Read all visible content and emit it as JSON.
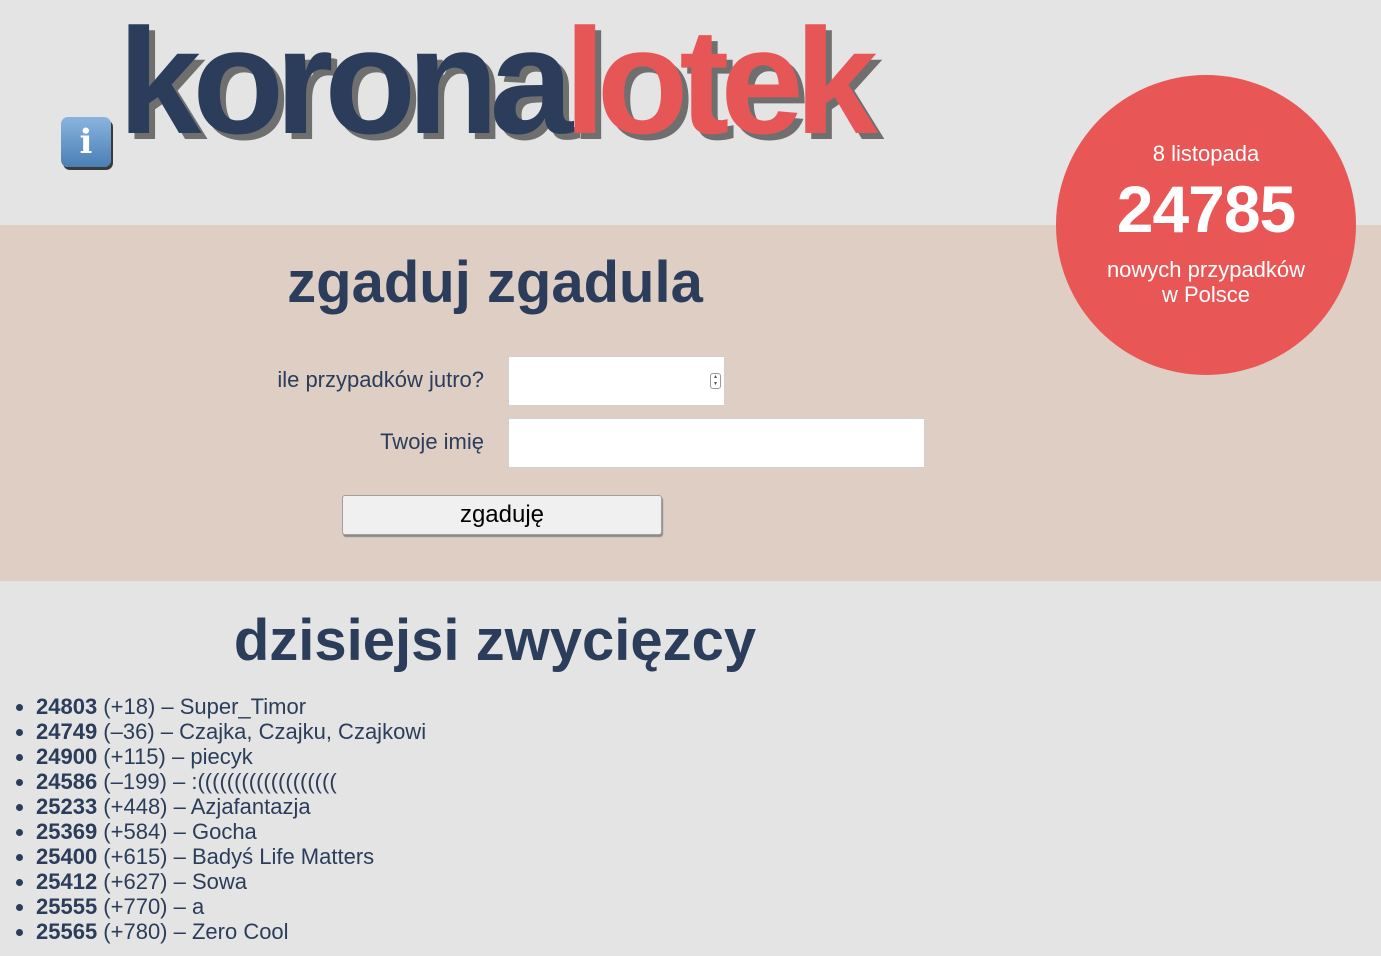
{
  "header": {
    "info_icon": "info-icon",
    "logo_part1": "korona",
    "logo_part2": "lotek"
  },
  "stats": {
    "date": "8 listopada",
    "count": "24785",
    "caption_line1": "nowych przypadków",
    "caption_line2": "w Polsce"
  },
  "guess": {
    "title": "zgaduj zgadula",
    "cases_label": "ile przypadków jutro?",
    "cases_value": "",
    "name_label": "Twoje imię",
    "name_value": "",
    "submit_label": "zgaduję"
  },
  "winners": {
    "title": "dzisiejsi zwycięzcy",
    "items": [
      {
        "guess": "24803",
        "diff": " (+18) – Super_Timor"
      },
      {
        "guess": "24749",
        "diff": " (–36) – Czajka, Czajku, Czajkowi"
      },
      {
        "guess": "24900",
        "diff": " (+115) – piecyk"
      },
      {
        "guess": "24586",
        "diff": " (–199) – :((((((((((((((((((("
      },
      {
        "guess": "25233",
        "diff": " (+448) – Azjafantazja"
      },
      {
        "guess": "25369",
        "diff": " (+584) – Gocha"
      },
      {
        "guess": "25400",
        "diff": " (+615) – Badyś Life Matters"
      },
      {
        "guess": "25412",
        "diff": " (+627) – Sowa"
      },
      {
        "guess": "25555",
        "diff": " (+770) – a"
      },
      {
        "guess": "25565",
        "diff": " (+780) – Zero Cool"
      }
    ]
  },
  "colors": {
    "navy": "#2b3d5b",
    "red": "#e75656",
    "bg": "#e4e4e4",
    "form_bg": "#decec4"
  }
}
